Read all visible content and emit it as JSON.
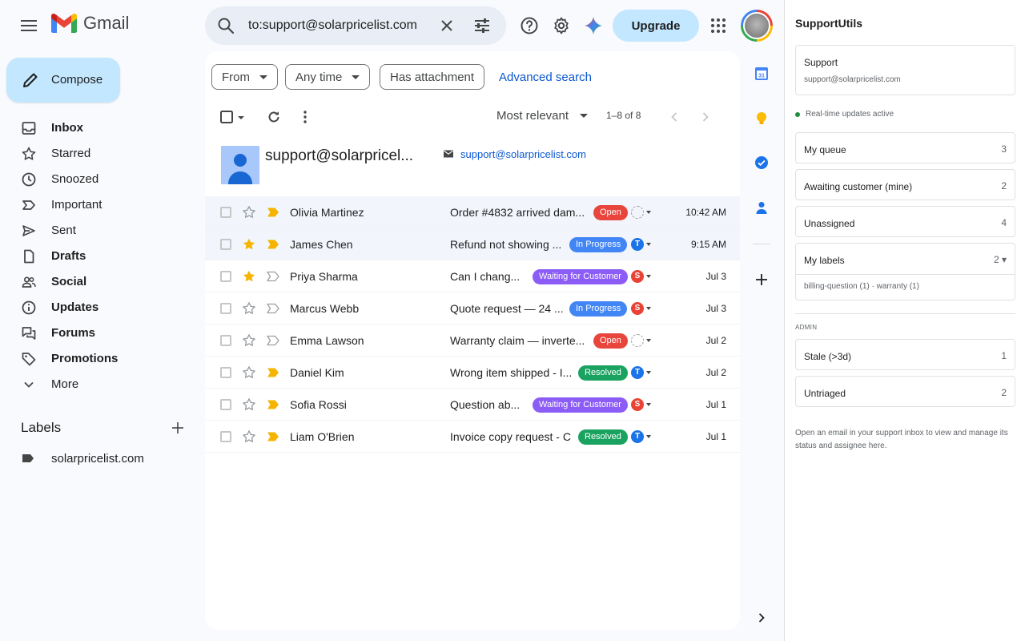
{
  "app": {
    "name": "Gmail"
  },
  "search": {
    "value": "to:support@solarpricelist.com"
  },
  "header": {
    "upgrade_label": "Upgrade"
  },
  "compose_label": "Compose",
  "nav": [
    {
      "label": "Inbox",
      "bold": true,
      "icon": "inbox-icon"
    },
    {
      "label": "Starred",
      "bold": false,
      "icon": "star-icon"
    },
    {
      "label": "Snoozed",
      "bold": false,
      "icon": "clock-icon"
    },
    {
      "label": "Important",
      "bold": false,
      "icon": "important-icon"
    },
    {
      "label": "Sent",
      "bold": false,
      "icon": "send-icon"
    },
    {
      "label": "Drafts",
      "bold": true,
      "icon": "draft-icon"
    },
    {
      "label": "Social",
      "bold": true,
      "icon": "people-icon"
    },
    {
      "label": "Updates",
      "bold": true,
      "icon": "info-icon"
    },
    {
      "label": "Forums",
      "bold": true,
      "icon": "forum-icon"
    },
    {
      "label": "Promotions",
      "bold": true,
      "icon": "tag-icon"
    },
    {
      "label": "More",
      "bold": false,
      "icon": "chevron-down-icon"
    }
  ],
  "labels": {
    "heading": "Labels",
    "items": [
      "solarpricelist.com"
    ]
  },
  "filters": {
    "from": "From",
    "any_time": "Any time",
    "has_attachment": "Has attachment",
    "advanced": "Advanced search"
  },
  "toolbar": {
    "sort": "Most relevant",
    "range": "1–8 of 8"
  },
  "contact": {
    "name": "support@solarpricel...",
    "email": "support@solarpricelist.com"
  },
  "status_colors": {
    "Open": "#e8453c",
    "In Progress": "#4285f4",
    "Waiting for Customer": "#8c5cf6",
    "Resolved": "#1aa260"
  },
  "emails": [
    {
      "sender": "Olivia Martinez",
      "subject": "Order #4832 arrived dam...",
      "status": "Open",
      "assignee": "",
      "assignee_color": "",
      "date": "10:42 AM",
      "starred": false,
      "important": true,
      "highlight": true
    },
    {
      "sender": "James Chen",
      "subject": "Refund not showing ...",
      "status": "In Progress",
      "assignee": "T",
      "assignee_color": "#1a73e8",
      "date": "9:15 AM",
      "starred": true,
      "important": true,
      "highlight": true
    },
    {
      "sender": "Priya Sharma",
      "subject": "Can I chang...",
      "status": "Waiting for Customer",
      "assignee": "S",
      "assignee_color": "#ea4335",
      "date": "Jul 3",
      "starred": true,
      "important": false,
      "highlight": false
    },
    {
      "sender": "Marcus Webb",
      "subject": "Quote request — 24 ...",
      "status": "In Progress",
      "assignee": "S",
      "assignee_color": "#ea4335",
      "date": "Jul 3",
      "starred": false,
      "important": false,
      "highlight": false
    },
    {
      "sender": "Emma Lawson",
      "subject": "Warranty claim — inverte...",
      "status": "Open",
      "assignee": "",
      "assignee_color": "",
      "date": "Jul 2",
      "starred": false,
      "important": false,
      "highlight": false
    },
    {
      "sender": "Daniel Kim",
      "subject": "Wrong item shipped - I...",
      "status": "Resolved",
      "assignee": "T",
      "assignee_color": "#1a73e8",
      "date": "Jul 2",
      "starred": false,
      "important": true,
      "highlight": false
    },
    {
      "sender": "Sofia Rossi",
      "subject": "Question ab...",
      "status": "Waiting for Customer",
      "assignee": "S",
      "assignee_color": "#ea4335",
      "date": "Jul 1",
      "starred": false,
      "important": true,
      "highlight": false
    },
    {
      "sender": "Liam O'Brien",
      "subject": "Invoice copy request - C",
      "status": "Resolved",
      "assignee": "T",
      "assignee_color": "#1a73e8",
      "date": "Jul 1",
      "starred": false,
      "important": true,
      "highlight": false
    }
  ],
  "panel": {
    "title": "SupportUtils",
    "inbox_name": "Support",
    "inbox_email": "support@solarpricelist.com",
    "realtime": "Real-time updates active",
    "queues": [
      {
        "label": "My queue",
        "count": "3"
      },
      {
        "label": "Awaiting customer (mine)",
        "count": "2"
      },
      {
        "label": "Unassigned",
        "count": "4"
      }
    ],
    "my_labels": {
      "label": "My labels",
      "count": "2 ▾",
      "sub": "billing-question (1) · warranty (1)"
    },
    "admin_heading": "ADMIN",
    "admin": [
      {
        "label": "Stale (>3d)",
        "count": "1"
      },
      {
        "label": "Untriaged",
        "count": "2"
      }
    ],
    "note": "Open an email in your support inbox to view and manage its status and assignee here."
  }
}
